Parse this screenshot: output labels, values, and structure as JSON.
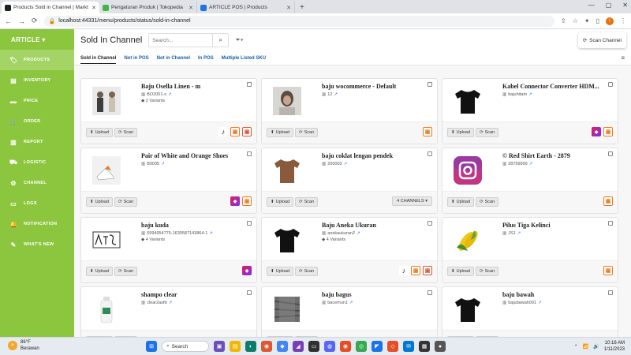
{
  "browser": {
    "tabs": [
      {
        "label": "Products Sold in Channel | Markt",
        "icon": "article-app-icon",
        "color": "#1f1f1f",
        "active": true
      },
      {
        "label": "Pengaturan Produk | Tokopedia",
        "icon": "tokopedia-icon",
        "color": "#42b549",
        "active": false
      },
      {
        "label": "ARTICLE POS | Products",
        "icon": "article-pos-icon",
        "color": "#1a73e8",
        "active": false
      }
    ],
    "url": "localhost:44331/menu/products/status/sold-in-channel",
    "profile_initial": "!"
  },
  "sidebar": {
    "brand": "ARTICLE ▾",
    "items": [
      {
        "label": "PRODUCTS",
        "icon": "tag-icon",
        "glyph": "🏷",
        "active": true
      },
      {
        "label": "INVENTORY",
        "icon": "inventory-icon",
        "glyph": "▤",
        "active": false
      },
      {
        "label": "PRICE",
        "icon": "price-icon",
        "glyph": "▬",
        "active": false
      },
      {
        "label": "ORDER",
        "icon": "cart-icon",
        "glyph": "🛒",
        "active": false
      },
      {
        "label": "REPORT",
        "icon": "report-icon",
        "glyph": "▥",
        "active": false
      },
      {
        "label": "LOGISTIC",
        "icon": "logistic-icon",
        "glyph": "⛟",
        "active": false
      },
      {
        "label": "CHANNEL",
        "icon": "channel-icon",
        "glyph": "⚙",
        "active": false
      },
      {
        "label": "LOGS",
        "icon": "logs-icon",
        "glyph": "▭",
        "active": false
      },
      {
        "label": "NOTIFICATION",
        "icon": "bell-icon",
        "glyph": "🔔",
        "active": false
      },
      {
        "label": "WHAT'S NEW",
        "icon": "news-icon",
        "glyph": "✎",
        "active": false
      }
    ]
  },
  "main": {
    "title": "Sold In Channel",
    "search_placeholder": "Search...",
    "scan_channel_label": "Scan Channel",
    "subtabs": [
      {
        "label": "Sold in Channel",
        "active": true
      },
      {
        "label": "Not in POS",
        "active": false
      },
      {
        "label": "Not in Channel",
        "active": false
      },
      {
        "label": "In POS",
        "active": false
      },
      {
        "label": "Multiple Listed SKU",
        "active": false
      }
    ]
  },
  "card_labels": {
    "upload": "Upload",
    "scan": "Scan"
  },
  "products": [
    {
      "name": "Baju Osella Linen - m",
      "sku": "BO2001-s",
      "variants": "2 Variants",
      "thumb": "people",
      "channels": [
        "tiktok",
        "toko",
        "shop"
      ]
    },
    {
      "name": "baju wocommerce - Default",
      "sku": "12",
      "variants": "",
      "thumb": "woman",
      "channels": [
        "toko"
      ]
    },
    {
      "name": "Kabel Connector Converter HDM...",
      "sku": "bajuhitam",
      "variants": "",
      "thumb": "tshirt-black",
      "channels": [
        "buka",
        "toko"
      ]
    },
    {
      "name": "Pair of White and Orange Shoes",
      "sku": "B0005",
      "variants": "",
      "thumb": "shoes",
      "channels": [
        "buka",
        "toko"
      ]
    },
    {
      "name": "baju coklat lengan pendek",
      "sku": "200003",
      "variants": "",
      "thumb": "tshirt-brown",
      "channels": [],
      "channels_btn": "4 CHANNELS ▾"
    },
    {
      "name": "© Red Shirt Earth - 2879",
      "sku": "28799999",
      "variants": "",
      "thumb": "instagram",
      "channels": [
        "toko"
      ]
    },
    {
      "name": "baju kuda",
      "sku": "6994954775-1639587143864-1",
      "variants": "4 Variants",
      "thumb": "sign",
      "channels": [
        "buka"
      ]
    },
    {
      "name": "Baju Aneka Ukuran",
      "sku": "anekaukuran2",
      "variants": "4 Variants",
      "thumb": "tshirt-black",
      "channels": [
        "tiktok",
        "toko",
        "shop"
      ]
    },
    {
      "name": "Pilus Tiga Kelinci",
      "sku": "JS1",
      "variants": "",
      "thumb": "corn",
      "channels": [
        "toko"
      ]
    },
    {
      "name": "shampo clear",
      "sku": "clear2asfd",
      "variants": "",
      "thumb": "bottle",
      "channels": []
    },
    {
      "name": "baju bagus",
      "sku": "bacemun1",
      "variants": "",
      "thumb": "fabric",
      "channels": []
    },
    {
      "name": "baju bawah",
      "sku": "bajubawah001",
      "variants": "",
      "thumb": "tshirt-black",
      "channels": []
    }
  ],
  "taskbar": {
    "weather_temp": "86°F",
    "weather_desc": "Berawan",
    "search_label": "Search",
    "time": "10:16 AM",
    "date": "1/11/2023"
  }
}
